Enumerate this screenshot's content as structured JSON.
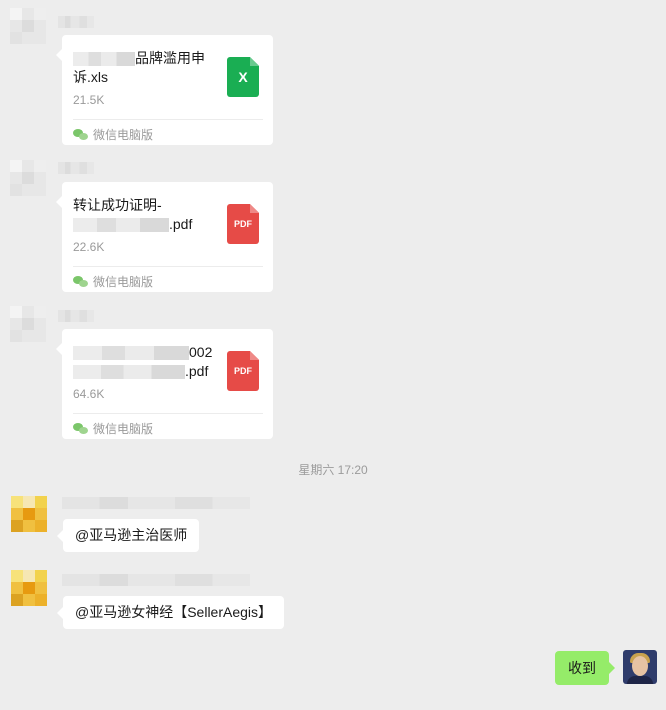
{
  "messages": [
    {
      "type": "file",
      "file": {
        "name_visible": "品牌滥用申诉.xls",
        "size": "21.5K",
        "source": "微信电脑版",
        "icon": "xls-file-icon",
        "icon_label": "X"
      }
    },
    {
      "type": "file",
      "file": {
        "name_visible_prefix": "转让成功证明-",
        "name_visible_suffix": ".pdf",
        "size": "22.6K",
        "source": "微信电脑版",
        "icon": "pdf-file-icon",
        "icon_label": "PDF"
      }
    },
    {
      "type": "file",
      "file": {
        "name_visible_line1_suffix": "002",
        "name_visible_line2_suffix": ".pdf",
        "size": "64.6K",
        "source": "微信电脑版",
        "icon": "pdf-file-icon",
        "icon_label": "PDF"
      }
    }
  ],
  "timestamp": "星期六 17:20",
  "text_messages": [
    {
      "text": "@亚马逊主治医师"
    },
    {
      "text": "@亚马逊女神经【SellerAegis】"
    }
  ],
  "self_message": {
    "text": "收到"
  },
  "colors": {
    "background": "#ededed",
    "bubble_other": "#ffffff",
    "bubble_self": "#95ec69",
    "xls_icon": "#1aae53",
    "pdf_icon": "#e64b47",
    "meta_text": "#9a9a9a"
  }
}
